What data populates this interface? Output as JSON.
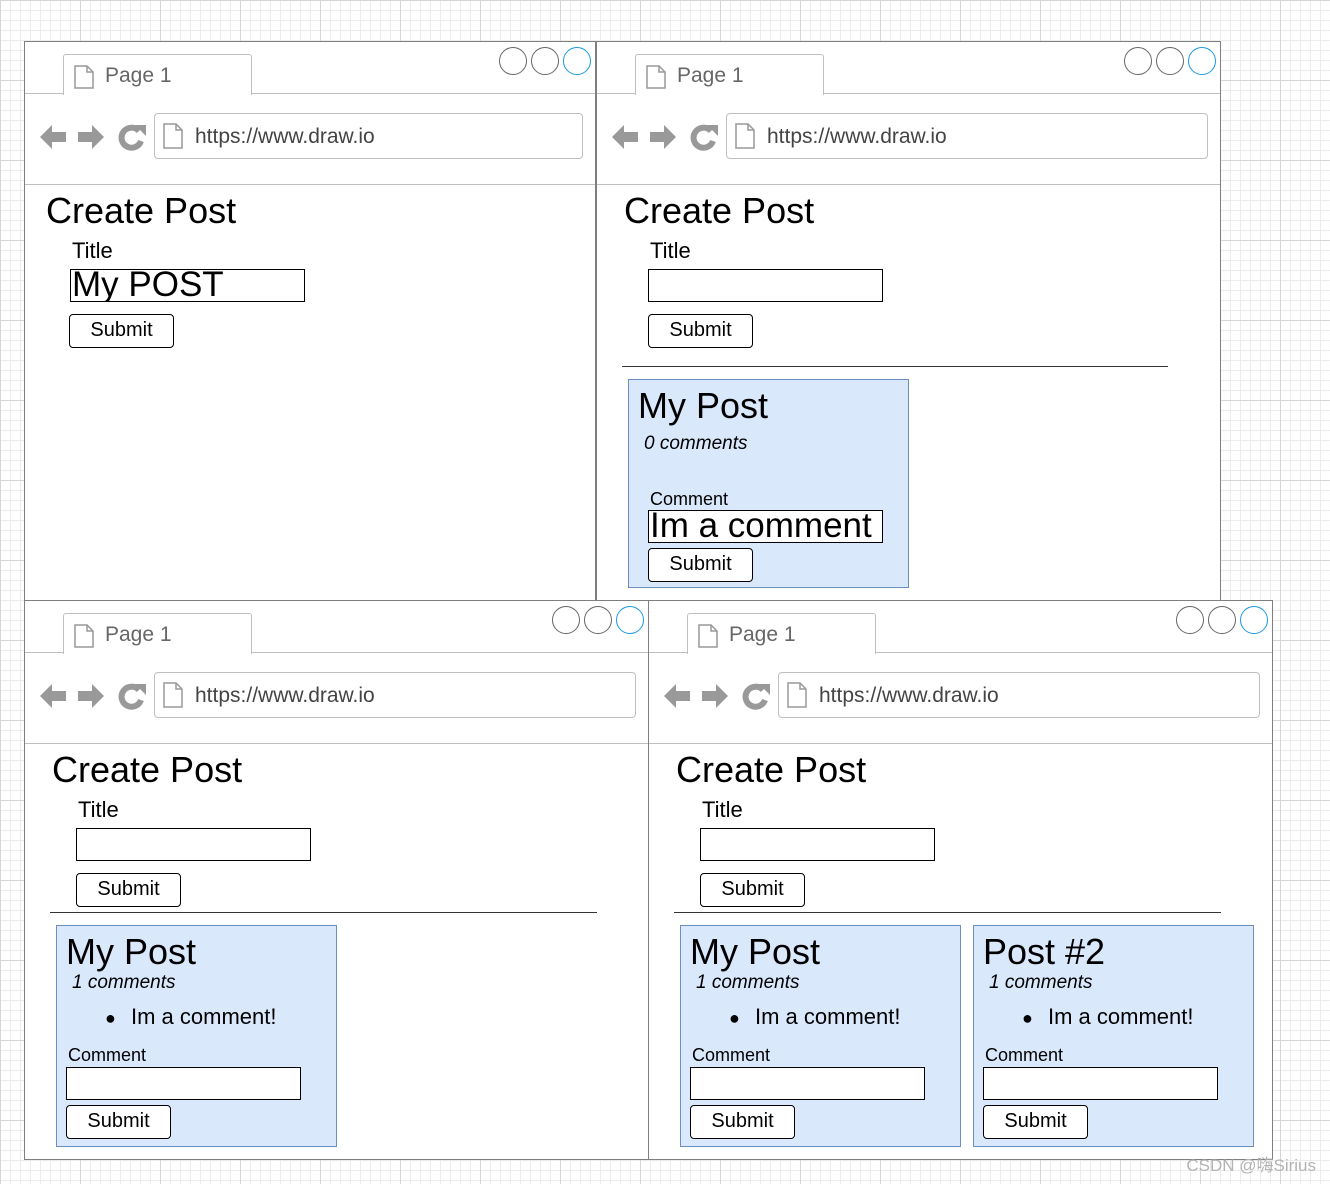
{
  "browser": {
    "tab_label": "Page 1",
    "url": "https://www.draw.io"
  },
  "form": {
    "heading": "Create Post",
    "title_label": "Title",
    "submit_label": "Submit"
  },
  "comment_form": {
    "label": "Comment",
    "submit_label": "Submit"
  },
  "frames": [
    {
      "title_value": "My POST"
    },
    {
      "title_value": "",
      "posts": [
        {
          "title": "My Post",
          "comment_count": "0 comments",
          "comment_value": "Im a comment"
        }
      ]
    },
    {
      "title_value": "",
      "posts": [
        {
          "title": "My Post",
          "comment_count": "1 comments",
          "comments": [
            "Im a comment!"
          ],
          "comment_value": ""
        }
      ]
    },
    {
      "title_value": "",
      "posts": [
        {
          "title": "My Post",
          "comment_count": "1 comments",
          "comments": [
            "Im a comment!"
          ],
          "comment_value": ""
        },
        {
          "title": "Post #2",
          "comment_count": "1 comments",
          "comments": [
            "Im a comment!"
          ],
          "comment_value": ""
        }
      ]
    }
  ],
  "watermark": "CSDN @嗨Sirius",
  "colors": {
    "card_fill": "#dae8fc",
    "card_border": "#6c8ebf",
    "window_button_accent": "#1a9ae0"
  },
  "icons": [
    "page-icon",
    "back-arrow-icon",
    "forward-arrow-icon",
    "reload-icon"
  ]
}
